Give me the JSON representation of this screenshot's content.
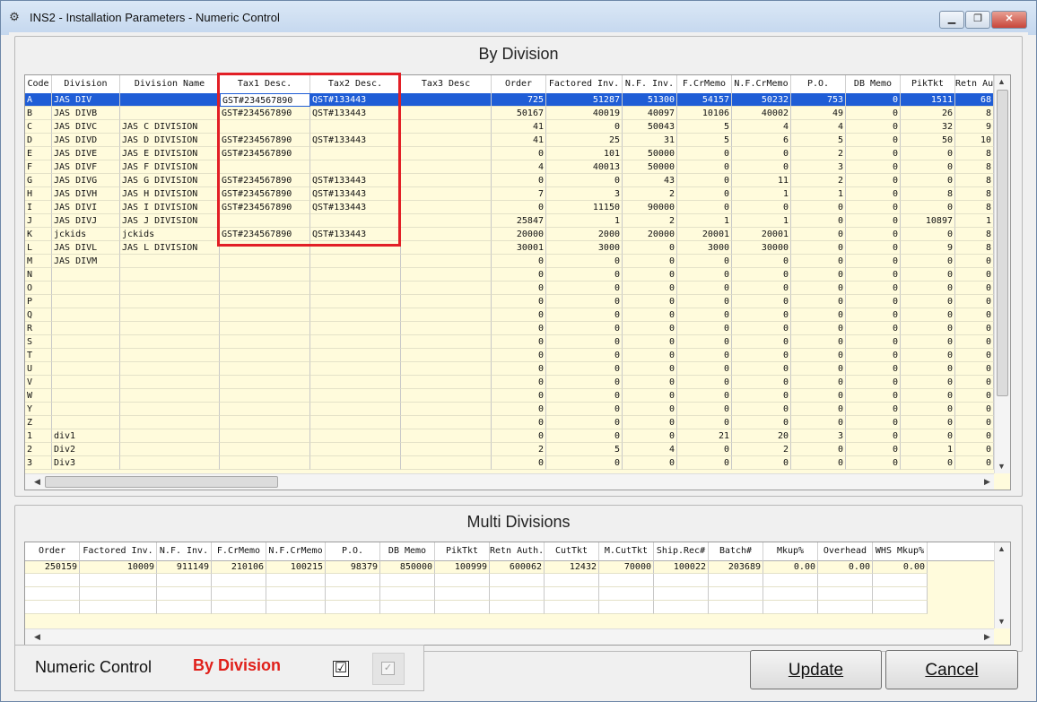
{
  "window": {
    "title": "INS2 - Installation Parameters - Numeric Control",
    "app_icon": "gear-app-icon",
    "controls": {
      "minimize": "▁",
      "restore": "❐",
      "close": "✕"
    }
  },
  "by_division": {
    "title": "By Division",
    "columns": [
      {
        "key": "code",
        "label": "Code",
        "w": 30,
        "num": false
      },
      {
        "key": "division",
        "label": "Division",
        "w": 76,
        "num": false
      },
      {
        "key": "division_name",
        "label": "Division Name",
        "w": 111,
        "num": false
      },
      {
        "key": "tax1",
        "label": "Tax1 Desc.",
        "w": 101,
        "num": false
      },
      {
        "key": "tax2",
        "label": "Tax2 Desc.",
        "w": 101,
        "num": false
      },
      {
        "key": "tax3",
        "label": "Tax3 Desc",
        "w": 101,
        "num": false
      },
      {
        "key": "order",
        "label": "Order",
        "w": 61,
        "num": true
      },
      {
        "key": "factored_inv",
        "label": "Factored Inv.",
        "w": 85,
        "num": true
      },
      {
        "key": "nf_inv",
        "label": "N.F. Inv.",
        "w": 61,
        "num": true
      },
      {
        "key": "f_crmemo",
        "label": "F.CrMemo",
        "w": 61,
        "num": true
      },
      {
        "key": "nf_crmemo",
        "label": "N.F.CrMemo",
        "w": 66,
        "num": true
      },
      {
        "key": "po",
        "label": "P.O.",
        "w": 61,
        "num": true
      },
      {
        "key": "db_memo",
        "label": "DB Memo",
        "w": 61,
        "num": true
      },
      {
        "key": "piktkt",
        "label": "PikTkt",
        "w": 61,
        "num": true
      },
      {
        "key": "retn_auth",
        "label": "Retn Auth",
        "w": 43,
        "num": true
      }
    ],
    "rows": [
      [
        "A",
        "JAS DIV",
        "",
        "GST#234567890",
        "QST#133443",
        "",
        "725",
        "51287",
        "51300",
        "54157",
        "50232",
        "753",
        "0",
        "1511",
        "68"
      ],
      [
        "B",
        "JAS DIVB",
        "",
        "GST#234567890",
        "QST#133443",
        "",
        "50167",
        "40019",
        "40097",
        "10106",
        "40002",
        "49",
        "0",
        "26",
        "8"
      ],
      [
        "C",
        "JAS DIVC",
        "JAS C DIVISION",
        "",
        "",
        "",
        "41",
        "0",
        "50043",
        "5",
        "4",
        "4",
        "0",
        "32",
        "9"
      ],
      [
        "D",
        "JAS DIVD",
        "JAS D DIVISION",
        "GST#234567890",
        "QST#133443",
        "",
        "41",
        "25",
        "31",
        "5",
        "6",
        "5",
        "0",
        "50",
        "10"
      ],
      [
        "E",
        "JAS DIVE",
        "JAS E DIVISION",
        "GST#234567890",
        "",
        "",
        "0",
        "101",
        "50000",
        "0",
        "0",
        "2",
        "0",
        "0",
        "8"
      ],
      [
        "F",
        "JAS DIVF",
        "JAS F DIVISION",
        "",
        "",
        "",
        "4",
        "40013",
        "50000",
        "0",
        "0",
        "3",
        "0",
        "0",
        "8"
      ],
      [
        "G",
        "JAS DIVG",
        "JAS G DIVISION",
        "GST#234567890",
        "QST#133443",
        "",
        "0",
        "0",
        "43",
        "0",
        "11",
        "2",
        "0",
        "0",
        "8"
      ],
      [
        "H",
        "JAS DIVH",
        "JAS H DIVISION",
        "GST#234567890",
        "QST#133443",
        "",
        "7",
        "3",
        "2",
        "0",
        "1",
        "1",
        "0",
        "8",
        "8"
      ],
      [
        "I",
        "JAS DIVI",
        "JAS I DIVISION",
        "GST#234567890",
        "QST#133443",
        "",
        "0",
        "11150",
        "90000",
        "0",
        "0",
        "0",
        "0",
        "0",
        "8"
      ],
      [
        "J",
        "JAS DIVJ",
        "JAS J DIVISION",
        "",
        "",
        "",
        "25847",
        "1",
        "2",
        "1",
        "1",
        "0",
        "0",
        "10897",
        "1"
      ],
      [
        "K",
        "jckids",
        "jckids",
        "GST#234567890",
        "QST#133443",
        "",
        "20000",
        "2000",
        "20000",
        "20001",
        "20001",
        "0",
        "0",
        "0",
        "8"
      ],
      [
        "L",
        "JAS DIVL",
        "JAS L DIVISION",
        "",
        "",
        "",
        "30001",
        "3000",
        "0",
        "3000",
        "30000",
        "0",
        "0",
        "9",
        "8"
      ],
      [
        "M",
        "JAS DIVM",
        "",
        "",
        "",
        "",
        "0",
        "0",
        "0",
        "0",
        "0",
        "0",
        "0",
        "0",
        "0"
      ],
      [
        "N",
        "",
        "",
        "",
        "",
        "",
        "0",
        "0",
        "0",
        "0",
        "0",
        "0",
        "0",
        "0",
        "0"
      ],
      [
        "O",
        "",
        "",
        "",
        "",
        "",
        "0",
        "0",
        "0",
        "0",
        "0",
        "0",
        "0",
        "0",
        "0"
      ],
      [
        "P",
        "",
        "",
        "",
        "",
        "",
        "0",
        "0",
        "0",
        "0",
        "0",
        "0",
        "0",
        "0",
        "0"
      ],
      [
        "Q",
        "",
        "",
        "",
        "",
        "",
        "0",
        "0",
        "0",
        "0",
        "0",
        "0",
        "0",
        "0",
        "0"
      ],
      [
        "R",
        "",
        "",
        "",
        "",
        "",
        "0",
        "0",
        "0",
        "0",
        "0",
        "0",
        "0",
        "0",
        "0"
      ],
      [
        "S",
        "",
        "",
        "",
        "",
        "",
        "0",
        "0",
        "0",
        "0",
        "0",
        "0",
        "0",
        "0",
        "0"
      ],
      [
        "T",
        "",
        "",
        "",
        "",
        "",
        "0",
        "0",
        "0",
        "0",
        "0",
        "0",
        "0",
        "0",
        "0"
      ],
      [
        "U",
        "",
        "",
        "",
        "",
        "",
        "0",
        "0",
        "0",
        "0",
        "0",
        "0",
        "0",
        "0",
        "0"
      ],
      [
        "V",
        "",
        "",
        "",
        "",
        "",
        "0",
        "0",
        "0",
        "0",
        "0",
        "0",
        "0",
        "0",
        "0"
      ],
      [
        "W",
        "",
        "",
        "",
        "",
        "",
        "0",
        "0",
        "0",
        "0",
        "0",
        "0",
        "0",
        "0",
        "0"
      ],
      [
        "Y",
        "",
        "",
        "",
        "",
        "",
        "0",
        "0",
        "0",
        "0",
        "0",
        "0",
        "0",
        "0",
        "0"
      ],
      [
        "Z",
        "",
        "",
        "",
        "",
        "",
        "0",
        "0",
        "0",
        "0",
        "0",
        "0",
        "0",
        "0",
        "0"
      ],
      [
        "1",
        "div1",
        "",
        "",
        "",
        "",
        "0",
        "0",
        "0",
        "21",
        "20",
        "3",
        "0",
        "0",
        "0"
      ],
      [
        "2",
        "Div2",
        "",
        "",
        "",
        "",
        "2",
        "5",
        "4",
        "0",
        "2",
        "0",
        "0",
        "1",
        "0"
      ],
      [
        "3",
        "Div3",
        "",
        "",
        "",
        "",
        "0",
        "0",
        "0",
        "0",
        "0",
        "0",
        "0",
        "0",
        "0"
      ]
    ],
    "selected_row": 0
  },
  "multi_divisions": {
    "title": "Multi Divisions",
    "columns": [
      {
        "key": "order",
        "label": "Order",
        "w": 61
      },
      {
        "key": "factored_inv",
        "label": "Factored Inv.",
        "w": 86
      },
      {
        "key": "nf_inv",
        "label": "N.F. Inv.",
        "w": 61
      },
      {
        "key": "f_crmemo",
        "label": "F.CrMemo",
        "w": 61
      },
      {
        "key": "nf_crmemo",
        "label": "N.F.CrMemo",
        "w": 66
      },
      {
        "key": "po",
        "label": "P.O.",
        "w": 61
      },
      {
        "key": "db_memo",
        "label": "DB Memo",
        "w": 61
      },
      {
        "key": "piktkt",
        "label": "PikTkt",
        "w": 61
      },
      {
        "key": "retn_auth",
        "label": "Retn Auth.",
        "w": 61
      },
      {
        "key": "cuttkt",
        "label": "CutTkt",
        "w": 61
      },
      {
        "key": "mcuttkt",
        "label": "M.CutTkt",
        "w": 61
      },
      {
        "key": "shiprec",
        "label": "Ship.Rec#",
        "w": 61
      },
      {
        "key": "batch",
        "label": "Batch#",
        "w": 61
      },
      {
        "key": "mkup",
        "label": "Mkup%",
        "w": 61
      },
      {
        "key": "overhead",
        "label": "Overhead",
        "w": 61
      },
      {
        "key": "whs_mkup",
        "label": "WHS Mkup%",
        "w": 61
      }
    ],
    "rows": [
      [
        "250159",
        "10009",
        "911149",
        "210106",
        "100215",
        "98379",
        "850000",
        "100999",
        "600062",
        "12432",
        "70000",
        "100022",
        "203689",
        "0.00",
        "0.00",
        "0.00"
      ],
      [
        "",
        "",
        "",
        "",
        "",
        "",
        "",
        "",
        "",
        "",
        "",
        "",
        "",
        "",
        "",
        ""
      ],
      [
        "",
        "",
        "",
        "",
        "",
        "",
        "",
        "",
        "",
        "",
        "",
        "",
        "",
        "",
        "",
        ""
      ],
      [
        "",
        "",
        "",
        "",
        "",
        "",
        "",
        "",
        "",
        "",
        "",
        "",
        "",
        "",
        "",
        ""
      ]
    ]
  },
  "footer": {
    "numeric_control_label": "Numeric Control",
    "by_division_label": "By Division",
    "checkbox_checked": "☑",
    "checkbox_disabled": "✓",
    "update_button": "Update",
    "cancel_button": "Cancel",
    "accent_color": "#e0201a"
  }
}
